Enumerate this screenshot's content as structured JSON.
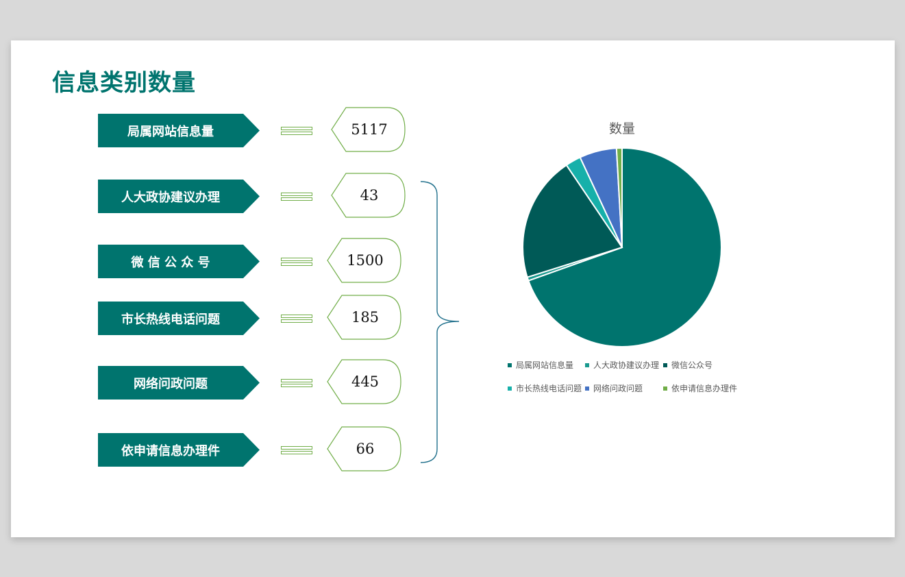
{
  "title": "信息类别数量",
  "rows": [
    {
      "label": "局属网站信息量",
      "value": "5117"
    },
    {
      "label": "人大政协建议办理",
      "value": "43"
    },
    {
      "label": "微 信 公 众 号",
      "value": "1500"
    },
    {
      "label": "市长热线电话问题",
      "value": "185"
    },
    {
      "label": "网络问政问题",
      "value": "445"
    },
    {
      "label": "依申请信息办理件",
      "value": "66"
    }
  ],
  "colors": {
    "accent": "#00746e",
    "box_border": "#70ad47"
  },
  "chart_data": {
    "type": "pie",
    "title": "数量",
    "categories": [
      "局属网站信息量",
      "人大政协建议办理",
      "微信公众号",
      "市长热线电话问题",
      "网络问政问题",
      "依申请信息办理件"
    ],
    "values": [
      5117,
      43,
      1500,
      185,
      445,
      66
    ],
    "colors": [
      "#00746e",
      "#1a9a8f",
      "#005a57",
      "#17b0aa",
      "#4472c4",
      "#70ad47"
    ],
    "legend_position": "bottom"
  }
}
